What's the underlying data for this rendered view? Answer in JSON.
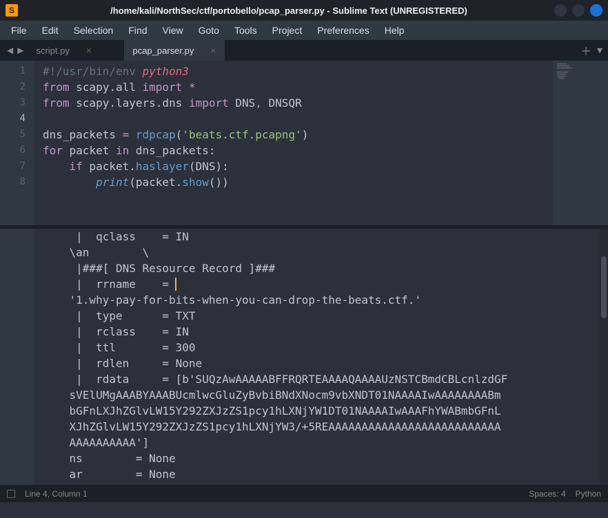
{
  "titlebar": {
    "icon_glyph": "S",
    "title": "/home/kali/NorthSec/ctf/portobello/pcap_parser.py - Sublime Text (UNREGISTERED)"
  },
  "menubar": [
    "File",
    "Edit",
    "Selection",
    "Find",
    "View",
    "Goto",
    "Tools",
    "Project",
    "Preferences",
    "Help"
  ],
  "tabs": [
    {
      "label": "script.py",
      "active": false
    },
    {
      "label": "pcap_parser.py",
      "active": true
    }
  ],
  "code": {
    "lines": [
      {
        "n": 1,
        "tokens": [
          [
            "shebang",
            "#!/usr/bin/env "
          ],
          [
            "err",
            "python3"
          ]
        ]
      },
      {
        "n": 2,
        "tokens": [
          [
            "kw",
            "from"
          ],
          [
            "",
            " scapy"
          ],
          [
            "",
            "."
          ],
          [
            "",
            "all "
          ],
          [
            "kw",
            "import"
          ],
          [
            "",
            " "
          ],
          [
            "op",
            "*"
          ]
        ]
      },
      {
        "n": 3,
        "tokens": [
          [
            "kw",
            "from"
          ],
          [
            "",
            " scapy"
          ],
          [
            "",
            "."
          ],
          [
            "",
            "layers"
          ],
          [
            "",
            "."
          ],
          [
            "",
            "dns "
          ],
          [
            "kw",
            "import"
          ],
          [
            "",
            " DNS"
          ],
          [
            "op",
            ","
          ],
          [
            "",
            " DNSQR"
          ]
        ]
      },
      {
        "n": 4,
        "tokens": []
      },
      {
        "n": 5,
        "tokens": [
          [
            "",
            "dns_packets "
          ],
          [
            "op",
            "="
          ],
          [
            "",
            " "
          ],
          [
            "fn",
            "rdpcap"
          ],
          [
            "",
            "("
          ],
          [
            "str",
            "'beats.ctf.pcapng'"
          ],
          [
            "",
            ")"
          ]
        ]
      },
      {
        "n": 6,
        "tokens": [
          [
            "kw",
            "for"
          ],
          [
            "",
            " packet "
          ],
          [
            "kw",
            "in"
          ],
          [
            "",
            " dns_packets:"
          ]
        ]
      },
      {
        "n": 7,
        "tokens": [
          [
            "",
            "    "
          ],
          [
            "kw",
            "if"
          ],
          [
            "",
            " packet"
          ],
          [
            "",
            "."
          ],
          [
            "meth",
            "haslayer"
          ],
          [
            "",
            "(DNS):"
          ]
        ]
      },
      {
        "n": 8,
        "tokens": [
          [
            "",
            "        "
          ],
          [
            "builtin",
            "print"
          ],
          [
            "",
            "(packet"
          ],
          [
            "",
            "."
          ],
          [
            "meth",
            "show"
          ],
          [
            "",
            "())"
          ]
        ]
      }
    ],
    "active_line": 4
  },
  "output_lines": [
    "     |  qclass    = IN",
    "    \\an        \\",
    "     |###[ DNS Resource Record ]###",
    "     |  rrname    = ",
    "    '1.why-pay-for-bits-when-you-can-drop-the-beats.ctf.'",
    "     |  type      = TXT",
    "     |  rclass    = IN",
    "     |  ttl       = 300",
    "     |  rdlen     = None",
    "     |  rdata     = [b'SUQzAwAAAAABFFRQRTEAAAAQAAAAUzNSTCBmdCBLcnlzdGF",
    "    sVElUMgAAABYAAABUcmlwcGluZyBvbiBNdXNocm9vbXNDT01NAAAAIwAAAAAAAABm",
    "    bGFnLXJhZGlvLW15Y292ZXJzZS1pcy1hLXNjYW1DT01NAAAAIwAAAFhYWABmbGFnL",
    "    XJhZGlvLW15Y292ZXJzZS1pcy1hLXNjYW3/+5REAAAAAAAAAAAAAAAAAAAAAAAAAA",
    "    AAAAAAAAAA']",
    "    ns        = None",
    "    ar        = None"
  ],
  "output_cursor_line": 3,
  "statusbar": {
    "pos": "Line 4, Column 1",
    "spaces": "Spaces: 4",
    "lang": "Python"
  }
}
